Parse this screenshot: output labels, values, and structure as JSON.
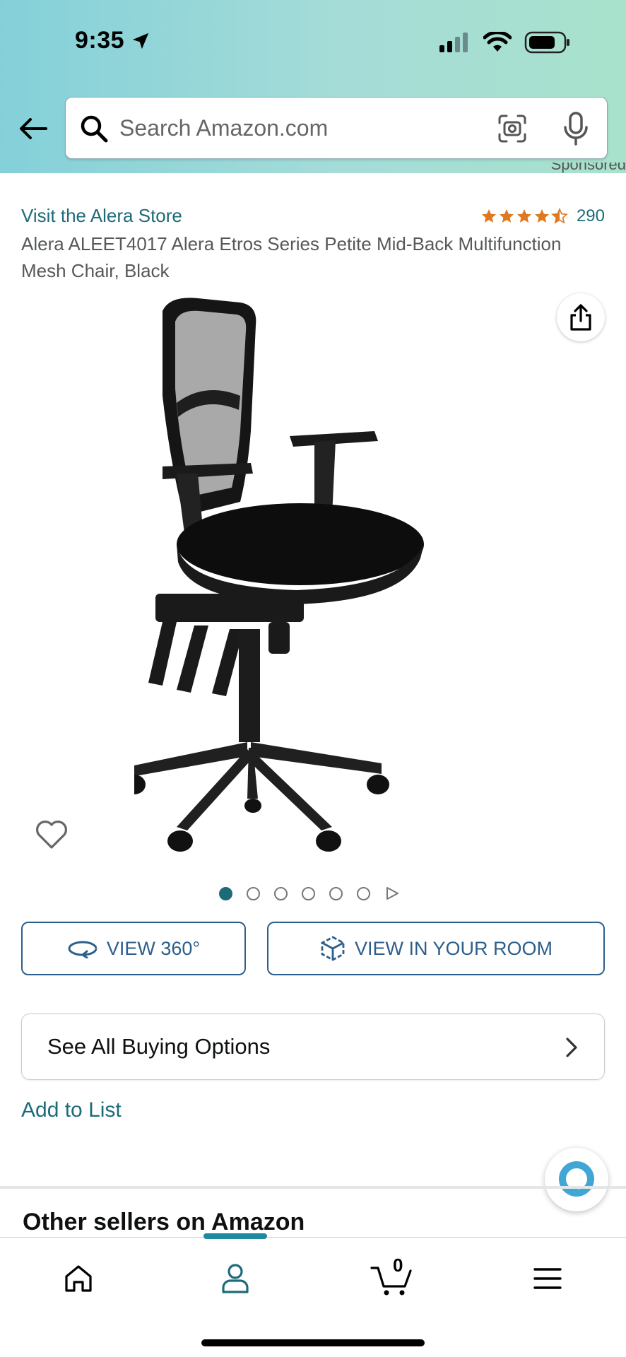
{
  "status_bar": {
    "time": "9:35"
  },
  "search": {
    "placeholder": "Search Amazon.com"
  },
  "sponsored_label": "Sponsored",
  "product": {
    "store_link": "Visit the Alera Store",
    "rating": 4.5,
    "rating_count": "290",
    "title": "Alera ALEET4017 Alera Etros Series Petite Mid-Back Multifunction Mesh Chair, Black",
    "image_count": 6
  },
  "buttons": {
    "view_360": "VIEW 360°",
    "view_in_room": "VIEW IN YOUR ROOM",
    "buying_options": "See All Buying Options",
    "add_to_list": "Add to List"
  },
  "sections": {
    "other_sellers": "Other sellers on Amazon"
  },
  "bottom_nav": {
    "cart_count": "0",
    "active_tab": "account"
  },
  "colors": {
    "accent": "#1d6b79",
    "star": "#de7921",
    "button_blue": "#2d5f8b"
  }
}
